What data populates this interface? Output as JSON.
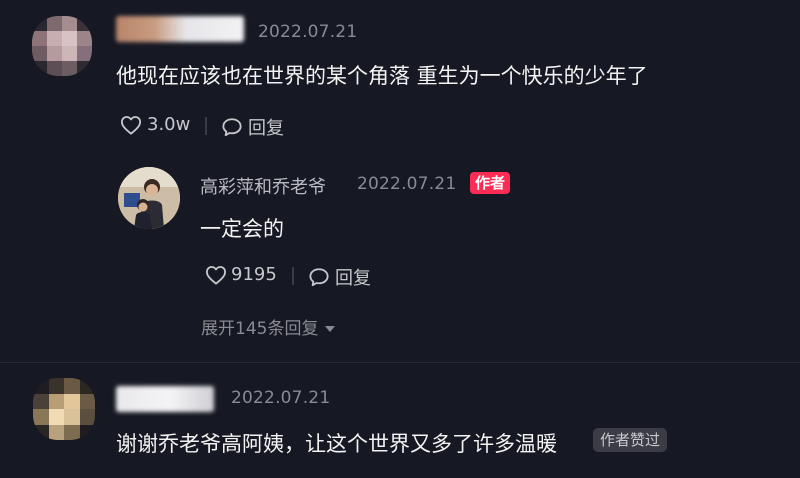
{
  "colors": {
    "background": "#161823",
    "author_badge": "#fe2c55",
    "muted_text": "#8a8b91",
    "action_text": "#c7c8cc"
  },
  "comments": [
    {
      "date": "2022.07.21",
      "text": "他现在应该也在世界的某个角落 重生为一个快乐的少年了",
      "like_icon": "heart-outline-icon",
      "likes": "3.0w",
      "reply_icon": "chat-bubble-icon",
      "reply_label": "回复",
      "replies": [
        {
          "author": "高彩萍和乔老爷",
          "date": "2022.07.21",
          "badge": "作者",
          "text": "一定会的",
          "likes": "9195",
          "reply_label": "回复"
        }
      ],
      "expand_label": "展开145条回复",
      "expand_icon": "caret-down-icon"
    },
    {
      "date": "2022.07.21",
      "text": "谢谢乔老爷高阿姨，让这个世界又多了许多温暖",
      "badge": "作者赞过"
    }
  ]
}
